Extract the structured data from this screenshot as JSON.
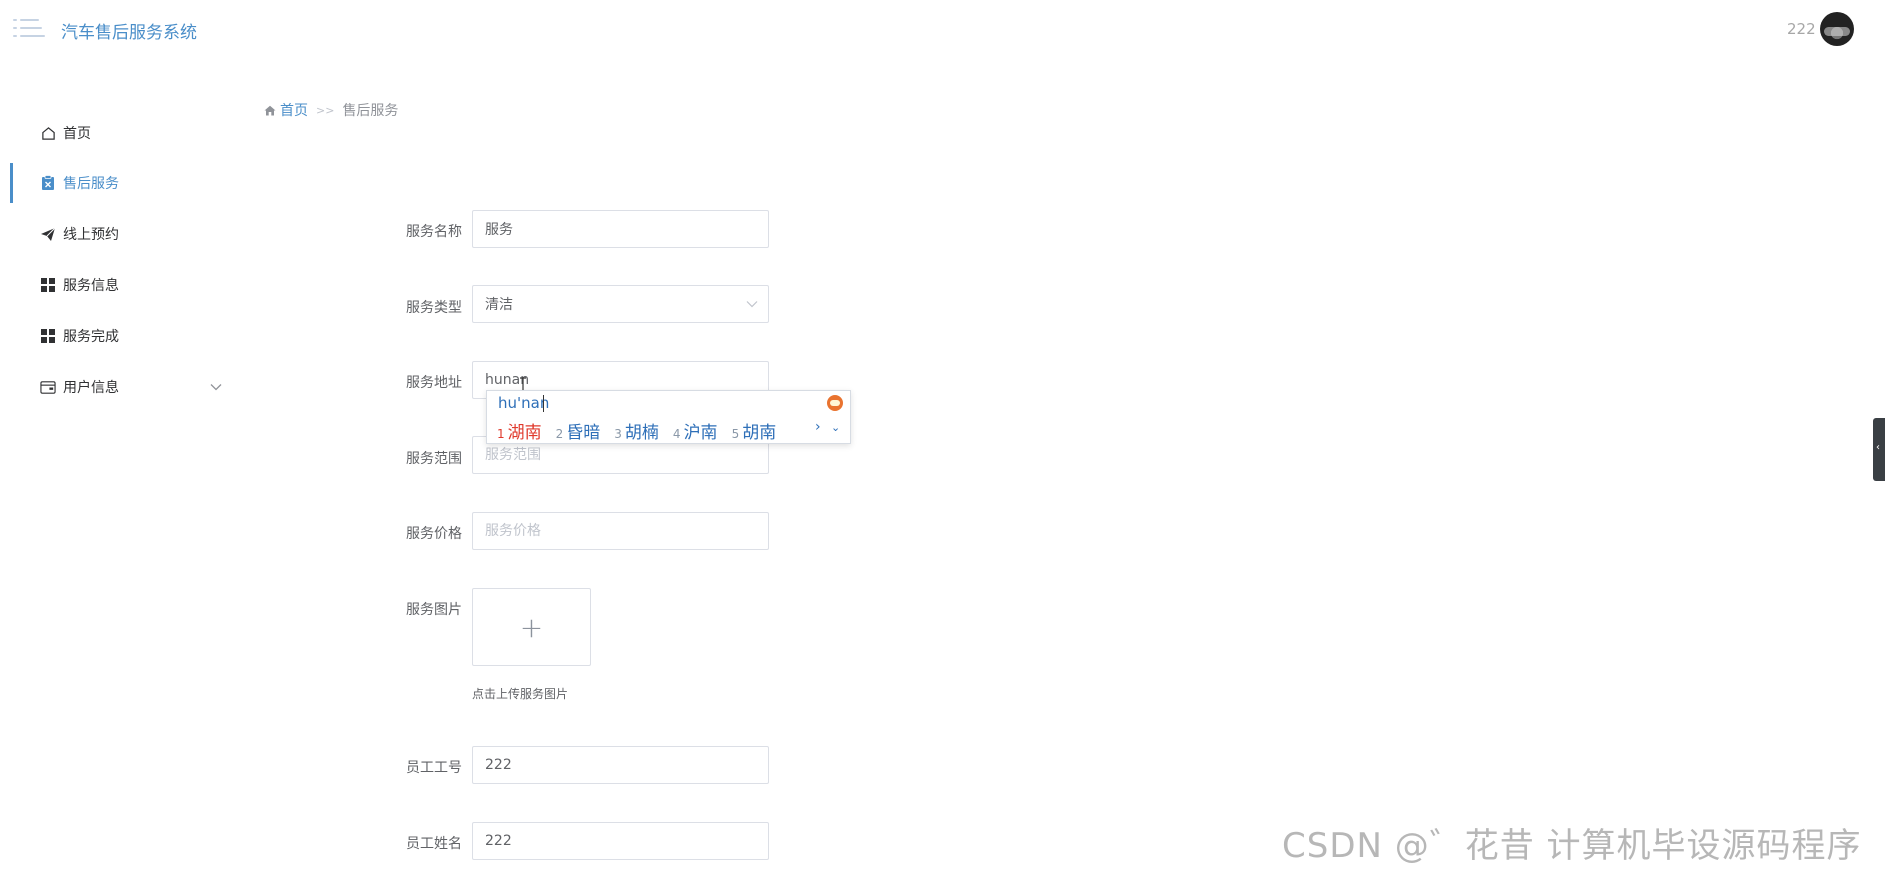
{
  "header": {
    "app_title": "汽车售后服务系统",
    "user_name": "222"
  },
  "sidebar": {
    "items": [
      {
        "label": "首页",
        "icon": "home-icon"
      },
      {
        "label": "售后服务",
        "icon": "clipboard-icon",
        "active": true
      },
      {
        "label": "线上预约",
        "icon": "send-icon"
      },
      {
        "label": "服务信息",
        "icon": "grid-icon"
      },
      {
        "label": "服务完成",
        "icon": "grid-icon"
      },
      {
        "label": "用户信息",
        "icon": "wallet-icon",
        "expandable": true
      }
    ]
  },
  "breadcrumb": {
    "home": "首页",
    "separator": ">>",
    "current": "售后服务"
  },
  "form": {
    "service_name": {
      "label": "服务名称",
      "value": "服务"
    },
    "service_type": {
      "label": "服务类型",
      "value": "清洁"
    },
    "service_address": {
      "label": "服务地址",
      "value": "hunan"
    },
    "service_range": {
      "label": "服务范围",
      "value": "",
      "placeholder": "服务范围"
    },
    "service_price": {
      "label": "服务价格",
      "value": "",
      "placeholder": "服务价格"
    },
    "service_image": {
      "label": "服务图片",
      "upload_symbol": "+",
      "hint": "点击上传服务图片"
    },
    "employee_id": {
      "label": "员工工号",
      "value": "222"
    },
    "employee_name": {
      "label": "员工姓名",
      "value": "222"
    }
  },
  "ime": {
    "pinyin": "hu'nan",
    "candidates": [
      {
        "num": "1",
        "text": "湖南"
      },
      {
        "num": "2",
        "text": "昏暗"
      },
      {
        "num": "3",
        "text": "胡楠"
      },
      {
        "num": "4",
        "text": "沪南"
      },
      {
        "num": "5",
        "text": "胡南"
      }
    ],
    "next": "›",
    "more": "⌄"
  },
  "watermark": "CSDN @゛花昔  计算机毕设源码程序",
  "colors": {
    "accent": "#4a8ec9",
    "ime_highlight": "#e03a2d",
    "border": "#dcdfe6"
  }
}
